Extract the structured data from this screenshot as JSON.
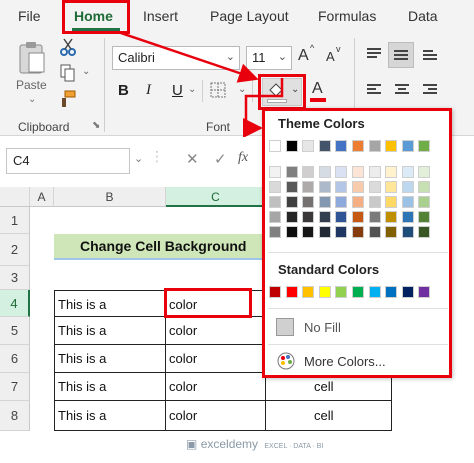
{
  "ribbon_tabs": [
    "File",
    "Home",
    "Insert",
    "Page Layout",
    "Formulas",
    "Data"
  ],
  "clipboard": {
    "paste_label": "Paste",
    "group_label": "Clipboard"
  },
  "font": {
    "name": "Calibri",
    "size": "11",
    "group_label": "Font",
    "bold": "B",
    "italic": "I",
    "underline": "U",
    "font_color": "A",
    "grow": "A",
    "shrink": "A"
  },
  "name_box": "C4",
  "formula_bar": {
    "cancel": "✕",
    "enter": "✓",
    "fx": "fx"
  },
  "columns": [
    "A",
    "B",
    "C"
  ],
  "rows": [
    "1",
    "2",
    "3",
    "4",
    "5",
    "6",
    "7",
    "8"
  ],
  "sheet": {
    "title": "Change Cell Background",
    "col_b": [
      "This is a",
      "This is a",
      "This is a",
      "This is a",
      "This is a"
    ],
    "col_c": [
      "color",
      "color",
      "color",
      "color",
      "color"
    ],
    "col_d": [
      "cell",
      "cell"
    ]
  },
  "fill_panel": {
    "theme_heading": "Theme Colors",
    "standard_heading": "Standard Colors",
    "no_fill": "No Fill",
    "more_colors": "More Colors...",
    "theme_top": [
      "#ffffff",
      "#000000",
      "#e7e6e6",
      "#44546a",
      "#4472c4",
      "#ed7d31",
      "#a5a5a5",
      "#ffc000",
      "#5b9bd5",
      "#70ad47"
    ],
    "theme_shades": [
      [
        "#f2f2f2",
        "#808080",
        "#d0cece",
        "#d6dce4",
        "#d9e1f2",
        "#fce4d6",
        "#ededed",
        "#fff2cc",
        "#ddebf7",
        "#e2efda"
      ],
      [
        "#d9d9d9",
        "#595959",
        "#aeaaaa",
        "#acb9ca",
        "#b4c6e7",
        "#f8cbad",
        "#dbdbdb",
        "#ffe699",
        "#bdd7ee",
        "#c6e0b4"
      ],
      [
        "#bfbfbf",
        "#404040",
        "#757171",
        "#8497b0",
        "#8ea9db",
        "#f4b084",
        "#c9c9c9",
        "#ffd966",
        "#9bc2e6",
        "#a9d08e"
      ],
      [
        "#a6a6a6",
        "#262626",
        "#3a3838",
        "#333f4f",
        "#2f5597",
        "#c65911",
        "#7b7b7b",
        "#bf8f00",
        "#2e75b6",
        "#548235"
      ],
      [
        "#808080",
        "#0d0d0d",
        "#161616",
        "#222b35",
        "#203764",
        "#843c0c",
        "#525252",
        "#806000",
        "#1f4e78",
        "#375623"
      ]
    ],
    "standard": [
      "#c00000",
      "#ff0000",
      "#ffc000",
      "#ffff00",
      "#92d050",
      "#00b050",
      "#00b0f0",
      "#0070c0",
      "#002060",
      "#7030a0"
    ]
  },
  "watermark": "exceldemy",
  "watermark_sub": "EXCEL · DATA · BI",
  "accent_color": "#217346",
  "highlight_color": "#e8000c"
}
